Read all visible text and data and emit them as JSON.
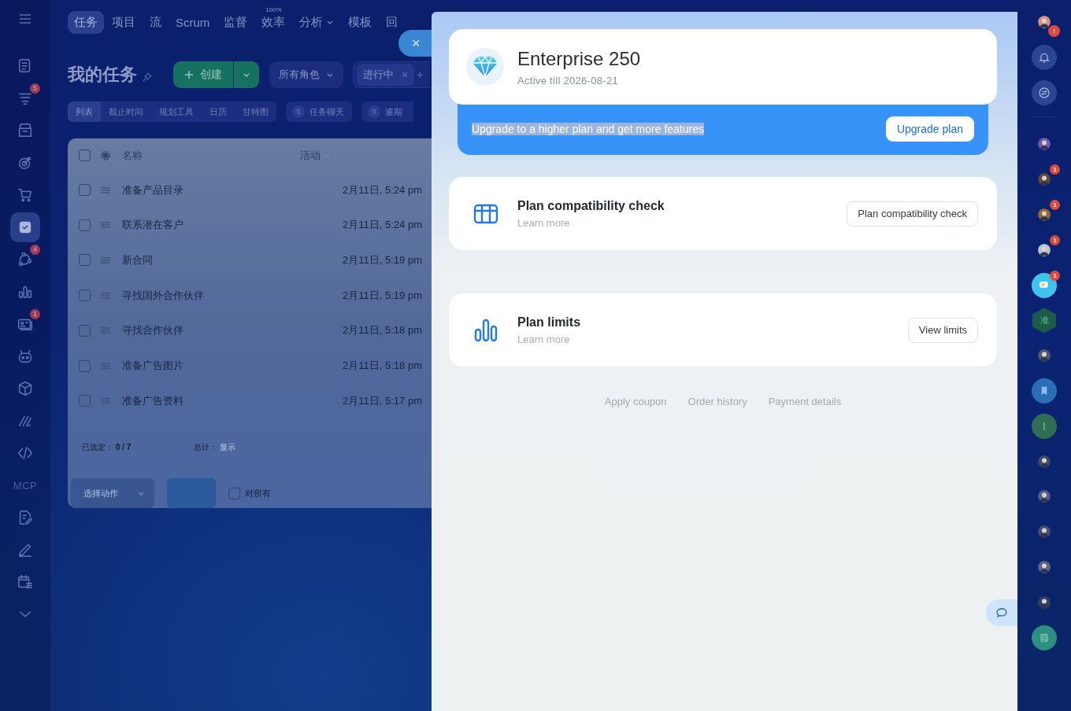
{
  "top_nav": {
    "items": [
      {
        "label": "任务",
        "selected": true
      },
      {
        "label": "项目",
        "selected": false
      },
      {
        "label": "流",
        "selected": false
      },
      {
        "label": "Scrum",
        "selected": false
      },
      {
        "label": "监督",
        "selected": false
      },
      {
        "label": "效率",
        "selected": false,
        "superscript": "100%"
      },
      {
        "label": "分析",
        "selected": false,
        "dropdown": true
      },
      {
        "label": "模板",
        "selected": false
      },
      {
        "label": "回",
        "selected": false
      }
    ]
  },
  "close": "×",
  "left_sidebar": {
    "items": [
      {
        "kind": "icon",
        "selected": false
      },
      {
        "kind": "icon",
        "selected": false,
        "badge": "5"
      },
      {
        "kind": "icon",
        "selected": false
      },
      {
        "kind": "icon",
        "selected": false
      },
      {
        "kind": "icon",
        "selected": false
      },
      {
        "kind": "icon",
        "selected": true
      },
      {
        "kind": "icon",
        "selected": false,
        "badge": "4"
      },
      {
        "kind": "icon",
        "selected": false
      },
      {
        "kind": "icon",
        "selected": false,
        "badge": "1"
      },
      {
        "kind": "icon",
        "selected": false
      },
      {
        "kind": "icon",
        "selected": false
      },
      {
        "kind": "icon",
        "selected": false
      },
      {
        "kind": "icon",
        "selected": false
      },
      {
        "kind": "text",
        "selected": false,
        "label": "MCP"
      },
      {
        "kind": "icon",
        "selected": false
      },
      {
        "kind": "icon",
        "selected": false
      },
      {
        "kind": "icon",
        "selected": false
      },
      {
        "kind": "icon",
        "selected": false
      }
    ]
  },
  "header": {
    "title": "我的任务",
    "create_button": "创建",
    "role_filter": "所有角色",
    "filter_chip": "进行中",
    "chip_remove": "×",
    "add_filter": "+"
  },
  "view_tabs": [
    {
      "label": "列表",
      "selected": true
    },
    {
      "label": "截止时间",
      "selected": false
    },
    {
      "label": "规划工具",
      "selected": false
    },
    {
      "label": "日历",
      "selected": false
    },
    {
      "label": "甘特图",
      "selected": false
    }
  ],
  "counters": [
    {
      "count": "0",
      "label": "任务聊天"
    },
    {
      "count": "0",
      "label": "逾期"
    }
  ],
  "task_table": {
    "all_checked": false,
    "columns": [
      "名称",
      "活动"
    ],
    "rows": [
      {
        "name": "准备产品目录",
        "activity": "2月11日, 5:24 pm",
        "checked": false
      },
      {
        "name": "联系潜在客户",
        "activity": "2月11日, 5:24 pm",
        "checked": false
      },
      {
        "name": "新合同",
        "activity": "2月11日, 5:19 pm",
        "checked": false
      },
      {
        "name": "寻找国外合作伙伴",
        "activity": "2月11日, 5:19 pm",
        "checked": false
      },
      {
        "name": "寻找合作伙伴",
        "activity": "2月11日, 5:18 pm",
        "checked": false
      },
      {
        "name": "准备广告图片",
        "activity": "2月11日, 5:18 pm",
        "checked": false
      },
      {
        "name": "准备广告资料",
        "activity": "2月11日, 5:17 pm",
        "checked": false
      }
    ],
    "selected_summary": {
      "label": "已选定：",
      "value": "0 / 7"
    },
    "total": {
      "label": "总计：",
      "link": "显示"
    },
    "action_select": "选择动作",
    "for_all": {
      "label": "对所有",
      "checked": false
    }
  },
  "plan_panel": {
    "plan": {
      "name": "Enterprise 250",
      "active_till": "Active till 2026-08-21"
    },
    "upgrade_banner": {
      "text": "Upgrade to a higher plan and get more features",
      "highlighted": true,
      "button": "Upgrade plan"
    },
    "cards": [
      {
        "kind": "compatibility",
        "title": "Plan compatibility check",
        "link": "Learn more",
        "button": "Plan compatibility check"
      },
      {
        "kind": "limits",
        "title": "Plan limits",
        "link": "Learn more",
        "button": "View limits"
      }
    ],
    "links": [
      "Apply coupon",
      "Order history",
      "Payment details"
    ]
  },
  "right_sidebar": {
    "items": [
      {
        "kind": "avatar",
        "color": "#d7907f",
        "badge": "!"
      },
      {
        "kind": "bell"
      },
      {
        "kind": "swap"
      },
      {
        "kind": "avatar",
        "color": "#6b5bb5"
      },
      {
        "kind": "avatar",
        "color": "#5a4a40",
        "badge": "1"
      },
      {
        "kind": "avatar",
        "color": "#8a6a3a",
        "badge": "1"
      },
      {
        "kind": "avatar",
        "color": "#b9c4d6",
        "badge": "1"
      },
      {
        "kind": "chat",
        "badge": "1"
      },
      {
        "kind": "hex",
        "label": "准"
      },
      {
        "kind": "avatar",
        "color": "#4a5878"
      },
      {
        "kind": "bookmark"
      },
      {
        "kind": "letter",
        "label": "I"
      },
      {
        "kind": "avatar",
        "color": "#3d4a6a"
      },
      {
        "kind": "avatar",
        "color": "#4f5f88"
      },
      {
        "kind": "avatar",
        "color": "#3e4f78"
      },
      {
        "kind": "avatar",
        "color": "#56678a"
      },
      {
        "kind": "avatar",
        "color": "#2f3f66"
      },
      {
        "kind": "doc"
      }
    ]
  }
}
